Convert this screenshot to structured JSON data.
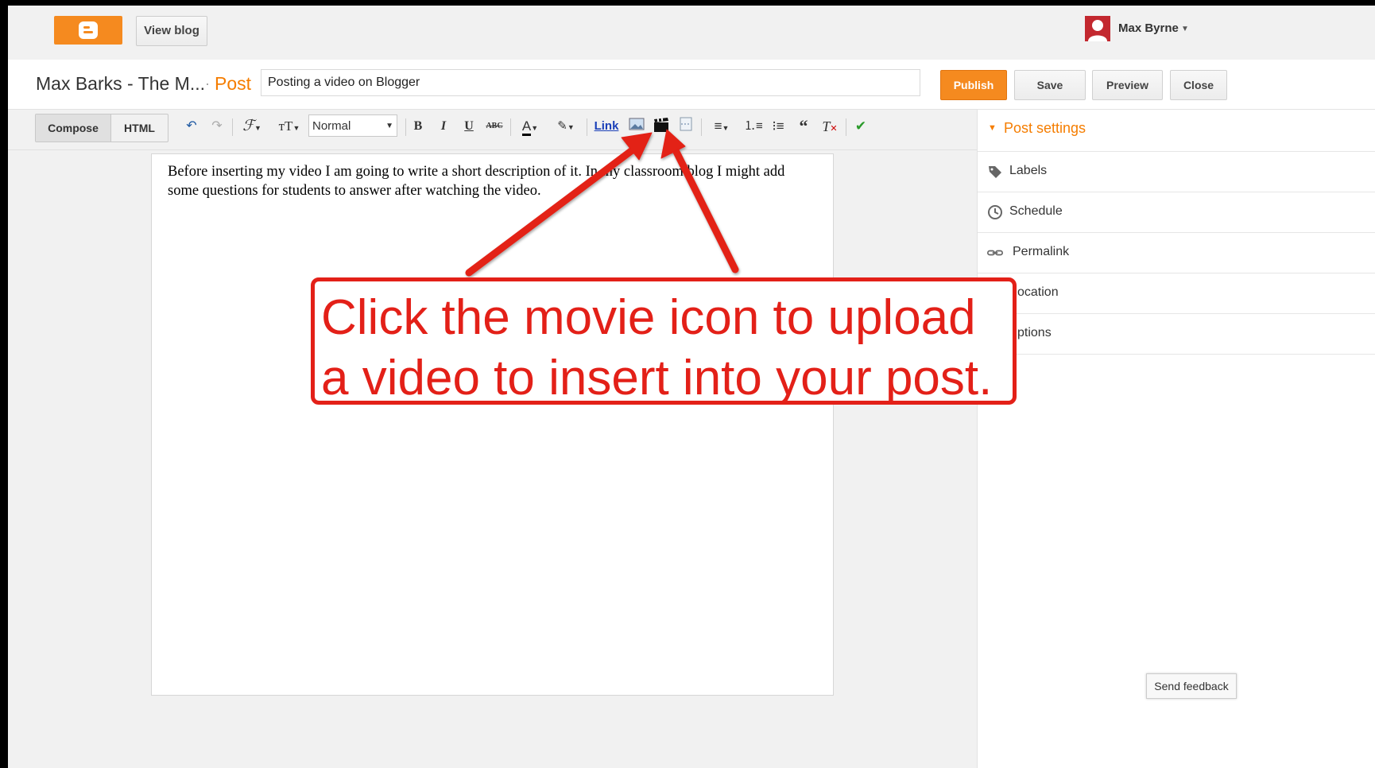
{
  "topbar": {
    "view_blog_label": "View blog",
    "user_name": "Max Byrne"
  },
  "header": {
    "blog_name": "Max Barks - The M...",
    "section_label": "Post",
    "post_title_value": "Posting a video on Blogger",
    "publish_label": "Publish",
    "save_label": "Save",
    "preview_label": "Preview",
    "close_label": "Close"
  },
  "toolbar": {
    "compose_tab": "Compose",
    "html_tab": "HTML",
    "font_size_value": "Normal",
    "bold_label": "B",
    "italic_label": "I",
    "underline_label": "U",
    "strike_label": "ABC",
    "link_label": "Link",
    "icons": [
      "undo-icon",
      "redo-icon",
      "font-family-icon",
      "font-size-icon",
      "text-color-icon",
      "highlight-icon",
      "insert-image-icon",
      "insert-video-icon",
      "jump-break-icon",
      "align-icon",
      "numbered-list-icon",
      "bullet-list-icon",
      "quote-icon",
      "remove-formatting-icon",
      "spellcheck-icon"
    ]
  },
  "editor": {
    "body_text": "Before inserting my video I am going to write a short description of it. In my classroom blog I might add some questions for students to answer after watching the video."
  },
  "sidebar": {
    "title": "Post settings",
    "items": [
      {
        "label": "Labels",
        "icon": "tag-icon"
      },
      {
        "label": "Schedule",
        "icon": "clock-icon"
      },
      {
        "label": "Permalink",
        "icon": "link-icon"
      },
      {
        "label": "ocation",
        "icon": "location-icon"
      },
      {
        "label": "ptions",
        "icon": "options-icon"
      }
    ]
  },
  "feedback_label": "Send feedback",
  "callout": {
    "line1": "Click the movie icon to upload",
    "line2": "a video to insert into your post."
  },
  "colors": {
    "accent_orange": "#f58a1f",
    "callout_red": "#e32018",
    "avatar_red": "#c3282f"
  }
}
